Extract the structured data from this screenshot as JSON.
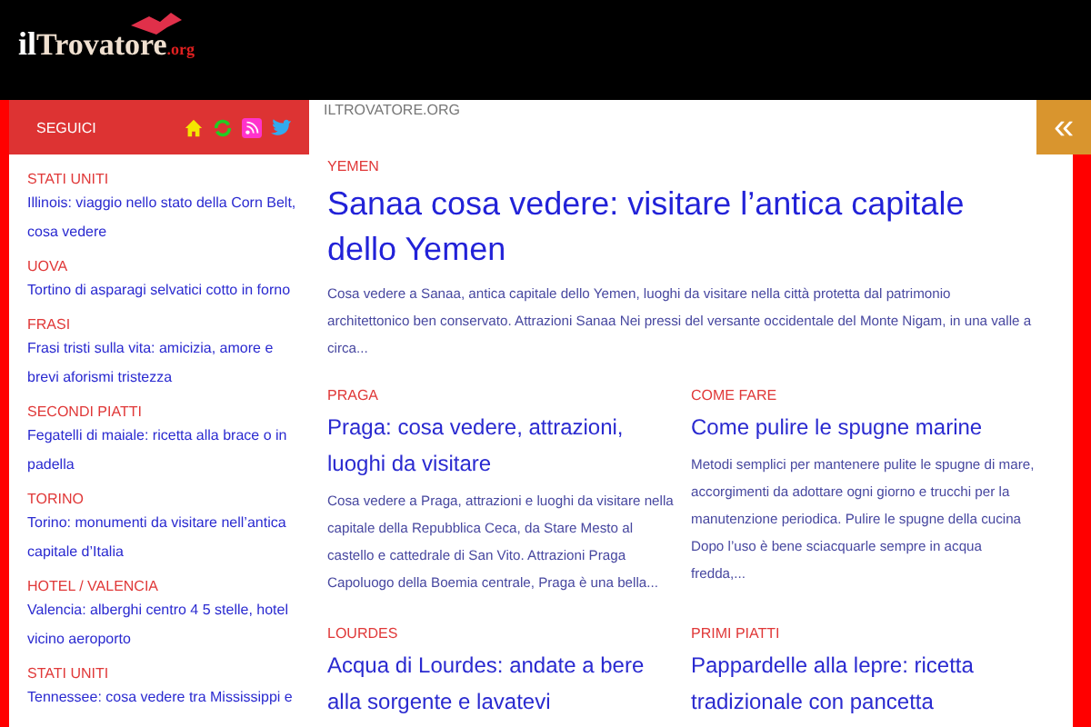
{
  "header": {
    "logo": {
      "prefix": "il",
      "main": "Trovatore",
      "suffix": ".org"
    }
  },
  "sidebar": {
    "title": "SEGUICI",
    "social": [
      {
        "kind": "home",
        "color": "#f5e600"
      },
      {
        "kind": "refresh",
        "color": "#22cc22"
      },
      {
        "kind": "rss",
        "color": "#ff33cc"
      },
      {
        "kind": "twitter",
        "color": "#33aaee"
      }
    ],
    "items": [
      {
        "category": "STATI UNITI",
        "title": "Illinois: viaggio nello stato della Corn Belt, cosa vedere"
      },
      {
        "category": "UOVA",
        "title": "Tortino di asparagi selvatici cotto in forno"
      },
      {
        "category": "FRASI",
        "title": "Frasi tristi sulla vita: amicizia, amore e brevi aforismi tristezza"
      },
      {
        "category": "SECONDI PIATTI",
        "title": "Fegatelli di maiale: ricetta alla brace o in padella"
      },
      {
        "category": "TORINO",
        "title": "Torino: monumenti da visitare nell’antica capitale d’Italia"
      },
      {
        "category": "HOTEL / VALENCIA",
        "title": "Valencia: alberghi centro 4 5 stelle, hotel vicino aeroporto"
      },
      {
        "category": "STATI UNITI",
        "title": "Tennessee: cosa vedere tra Mississippi e"
      }
    ]
  },
  "breadcrumb": "ILTROVATORE.ORG",
  "toggle": {
    "label": "«"
  },
  "featured": {
    "category": "YEMEN",
    "title": "Sanaa cosa vedere: visitare l’antica capitale dello Yemen",
    "excerpt": "Cosa vedere a Sanaa, antica capitale dello Yemen, luoghi da visitare nella città protetta dal patrimonio architettonico ben conservato. Attrazioni Sanaa Nei pressi del versante occidentale del Monte Nigam, in una valle a circa..."
  },
  "articles": [
    {
      "category": "PRAGA",
      "title": "Praga: cosa vedere, attrazioni, luoghi da visitare",
      "excerpt": "Cosa vedere a Praga, attrazioni e luoghi da visitare nella capitale della Repubblica Ceca, da Stare Mesto al castello e cattedrale di San Vito. Attrazioni Praga Capoluogo della Boemia centrale, Praga è una bella..."
    },
    {
      "category": "COME FARE",
      "title": "Come pulire le spugne marine",
      "excerpt": "Metodi semplici per mantenere pulite le spugne di mare, accorgimenti da adottare ogni giorno e trucchi per la manutenzione periodica. Pulire le spugne della cucina Dopo l’uso è bene sciacquarle sempre in acqua fredda,..."
    },
    {
      "category": "LOURDES",
      "title": "Acqua di Lourdes: andate a bere alla sorgente e lavatevi"
    },
    {
      "category": "PRIMI PIATTI",
      "title": "Pappardelle alla lepre: ricetta tradizionale con pancetta"
    }
  ]
}
